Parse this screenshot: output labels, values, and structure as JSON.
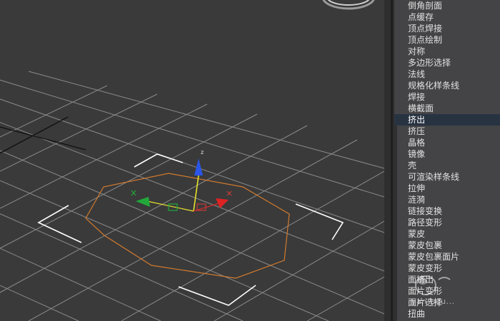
{
  "viewport": {
    "axis_label": "z"
  },
  "menu": {
    "items": [
      {
        "label": "倒角剖面"
      },
      {
        "label": "点缓存"
      },
      {
        "label": "顶点焊接"
      },
      {
        "label": "顶点绘制"
      },
      {
        "label": "对称"
      },
      {
        "label": "多边形选择"
      },
      {
        "label": "法线"
      },
      {
        "label": "规格化样条线"
      },
      {
        "label": "焊接"
      },
      {
        "label": "横截面"
      },
      {
        "label": "挤出"
      },
      {
        "label": "挤压"
      },
      {
        "label": "晶格"
      },
      {
        "label": "镜像"
      },
      {
        "label": "壳"
      },
      {
        "label": "可渲染样条线"
      },
      {
        "label": "拉伸"
      },
      {
        "label": "涟漪"
      },
      {
        "label": "链接变换"
      },
      {
        "label": "路径变形"
      },
      {
        "label": "蒙皮"
      },
      {
        "label": "蒙皮包裹"
      },
      {
        "label": "蒙皮包裹面片"
      },
      {
        "label": "蒙皮变形"
      },
      {
        "label": "面挤出"
      },
      {
        "label": "面片变形"
      },
      {
        "label": "面片选择"
      },
      {
        "label": "扭曲"
      }
    ],
    "selected_index": 10
  },
  "watermark": {
    "text": "yan-bdu..."
  }
}
